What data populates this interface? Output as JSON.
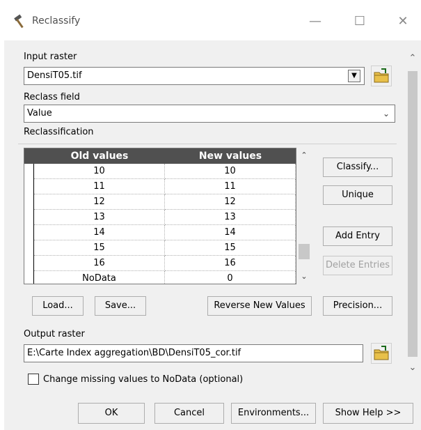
{
  "window": {
    "title": "Reclassify",
    "minimize": "—",
    "maximize": "☐",
    "close": "✕"
  },
  "input_raster": {
    "label": "Input raster",
    "value": "DensiT05.tif"
  },
  "reclass_field": {
    "label": "Reclass field",
    "value": "Value"
  },
  "reclassification": {
    "label": "Reclassification",
    "columns": [
      "Old values",
      "New values"
    ],
    "rows": [
      {
        "old": "10",
        "new": "10"
      },
      {
        "old": "11",
        "new": "11"
      },
      {
        "old": "12",
        "new": "12"
      },
      {
        "old": "13",
        "new": "13"
      },
      {
        "old": "14",
        "new": "14"
      },
      {
        "old": "15",
        "new": "15"
      },
      {
        "old": "16",
        "new": "16"
      },
      {
        "old": "NoData",
        "new": "0"
      }
    ],
    "buttons": {
      "classify": "Classify...",
      "unique": "Unique",
      "add_entry": "Add Entry",
      "delete_entries": "Delete Entries",
      "load": "Load...",
      "save": "Save...",
      "reverse": "Reverse New Values",
      "precision": "Precision..."
    }
  },
  "output_raster": {
    "label": "Output raster",
    "value": "E:\\Carte Index aggregation\\BD\\DensiT05_cor.tif"
  },
  "change_missing": {
    "label": "Change missing values to NoData (optional)",
    "checked": false
  },
  "footer": {
    "ok": "OK",
    "cancel": "Cancel",
    "environments": "Environments...",
    "show_help": "Show Help >>"
  },
  "colors": {
    "header_bg": "#505050",
    "folder_yellow": "#e8c04a"
  }
}
